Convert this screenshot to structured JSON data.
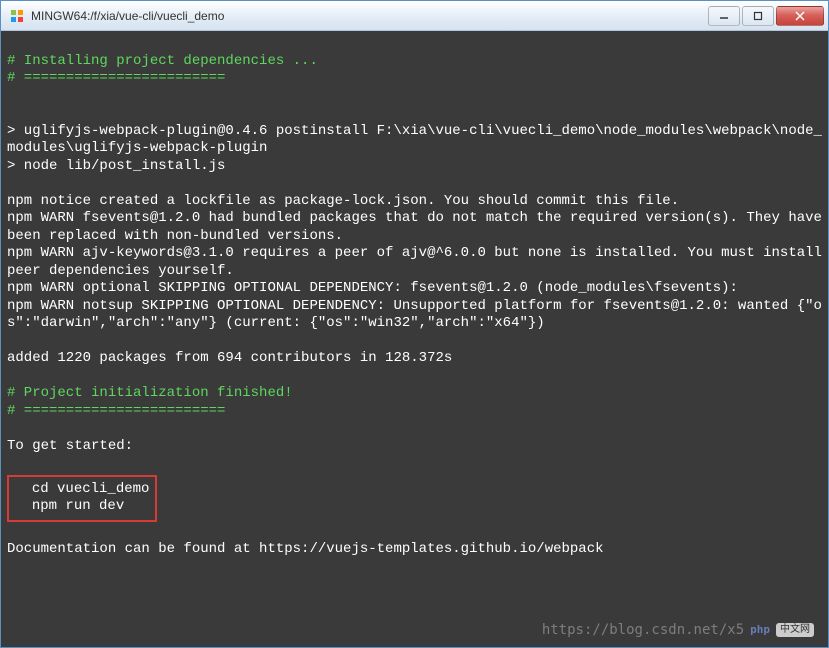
{
  "window": {
    "title": "MINGW64:/f/xia/vue-cli/vuecli_demo"
  },
  "terminal": {
    "section_install_header": "# Installing project dependencies ...",
    "section_divider": "# ========================",
    "cmd_uglify": "> uglifyjs-webpack-plugin@0.4.6 postinstall F:\\xia\\vue-cli\\vuecli_demo\\node_modules\\webpack\\node_modules\\uglifyjs-webpack-plugin",
    "cmd_node": "> node lib/post_install.js",
    "npm_notice": "npm notice created a lockfile as package-lock.json. You should commit this file.",
    "npm_warn_fsevents": "npm WARN fsevents@1.2.0 had bundled packages that do not match the required version(s). They have been replaced with non-bundled versions.",
    "npm_warn_ajv": "npm WARN ajv-keywords@3.1.0 requires a peer of ajv@^6.0.0 but none is installed. You must install peer dependencies yourself.",
    "npm_warn_optional": "npm WARN optional SKIPPING OPTIONAL DEPENDENCY: fsevents@1.2.0 (node_modules\\fsevents):",
    "npm_warn_notsup": "npm WARN notsup SKIPPING OPTIONAL DEPENDENCY: Unsupported platform for fsevents@1.2.0: wanted {\"os\":\"darwin\",\"arch\":\"any\"} (current: {\"os\":\"win32\",\"arch\":\"x64\"})",
    "added_packages": "added 1220 packages from 694 contributors in 128.372s",
    "init_finished": "# Project initialization finished!",
    "init_divider": "# ========================",
    "to_get_started": "To get started:",
    "cmd_cd": "  cd vuecli_demo",
    "cmd_npm_run": "  npm run dev",
    "docs": "Documentation can be found at https://vuejs-templates.github.io/webpack"
  },
  "watermark": {
    "text": "https://blog.csdn.net/x5",
    "badge1": "php",
    "badge2": "中文网"
  }
}
